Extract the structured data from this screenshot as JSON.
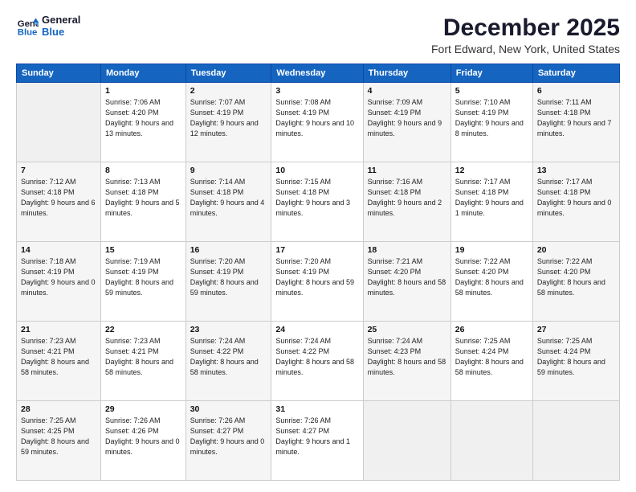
{
  "header": {
    "logo_line1": "General",
    "logo_line2": "Blue",
    "title": "December 2025",
    "subtitle": "Fort Edward, New York, United States"
  },
  "weekdays": [
    "Sunday",
    "Monday",
    "Tuesday",
    "Wednesday",
    "Thursday",
    "Friday",
    "Saturday"
  ],
  "weeks": [
    [
      {
        "day": "",
        "sunrise": "",
        "sunset": "",
        "daylight": ""
      },
      {
        "day": "1",
        "sunrise": "Sunrise: 7:06 AM",
        "sunset": "Sunset: 4:20 PM",
        "daylight": "Daylight: 9 hours and 13 minutes."
      },
      {
        "day": "2",
        "sunrise": "Sunrise: 7:07 AM",
        "sunset": "Sunset: 4:19 PM",
        "daylight": "Daylight: 9 hours and 12 minutes."
      },
      {
        "day": "3",
        "sunrise": "Sunrise: 7:08 AM",
        "sunset": "Sunset: 4:19 PM",
        "daylight": "Daylight: 9 hours and 10 minutes."
      },
      {
        "day": "4",
        "sunrise": "Sunrise: 7:09 AM",
        "sunset": "Sunset: 4:19 PM",
        "daylight": "Daylight: 9 hours and 9 minutes."
      },
      {
        "day": "5",
        "sunrise": "Sunrise: 7:10 AM",
        "sunset": "Sunset: 4:19 PM",
        "daylight": "Daylight: 9 hours and 8 minutes."
      },
      {
        "day": "6",
        "sunrise": "Sunrise: 7:11 AM",
        "sunset": "Sunset: 4:18 PM",
        "daylight": "Daylight: 9 hours and 7 minutes."
      }
    ],
    [
      {
        "day": "7",
        "sunrise": "Sunrise: 7:12 AM",
        "sunset": "Sunset: 4:18 PM",
        "daylight": "Daylight: 9 hours and 6 minutes."
      },
      {
        "day": "8",
        "sunrise": "Sunrise: 7:13 AM",
        "sunset": "Sunset: 4:18 PM",
        "daylight": "Daylight: 9 hours and 5 minutes."
      },
      {
        "day": "9",
        "sunrise": "Sunrise: 7:14 AM",
        "sunset": "Sunset: 4:18 PM",
        "daylight": "Daylight: 9 hours and 4 minutes."
      },
      {
        "day": "10",
        "sunrise": "Sunrise: 7:15 AM",
        "sunset": "Sunset: 4:18 PM",
        "daylight": "Daylight: 9 hours and 3 minutes."
      },
      {
        "day": "11",
        "sunrise": "Sunrise: 7:16 AM",
        "sunset": "Sunset: 4:18 PM",
        "daylight": "Daylight: 9 hours and 2 minutes."
      },
      {
        "day": "12",
        "sunrise": "Sunrise: 7:17 AM",
        "sunset": "Sunset: 4:18 PM",
        "daylight": "Daylight: 9 hours and 1 minute."
      },
      {
        "day": "13",
        "sunrise": "Sunrise: 7:17 AM",
        "sunset": "Sunset: 4:18 PM",
        "daylight": "Daylight: 9 hours and 0 minutes."
      }
    ],
    [
      {
        "day": "14",
        "sunrise": "Sunrise: 7:18 AM",
        "sunset": "Sunset: 4:19 PM",
        "daylight": "Daylight: 9 hours and 0 minutes."
      },
      {
        "day": "15",
        "sunrise": "Sunrise: 7:19 AM",
        "sunset": "Sunset: 4:19 PM",
        "daylight": "Daylight: 8 hours and 59 minutes."
      },
      {
        "day": "16",
        "sunrise": "Sunrise: 7:20 AM",
        "sunset": "Sunset: 4:19 PM",
        "daylight": "Daylight: 8 hours and 59 minutes."
      },
      {
        "day": "17",
        "sunrise": "Sunrise: 7:20 AM",
        "sunset": "Sunset: 4:19 PM",
        "daylight": "Daylight: 8 hours and 59 minutes."
      },
      {
        "day": "18",
        "sunrise": "Sunrise: 7:21 AM",
        "sunset": "Sunset: 4:20 PM",
        "daylight": "Daylight: 8 hours and 58 minutes."
      },
      {
        "day": "19",
        "sunrise": "Sunrise: 7:22 AM",
        "sunset": "Sunset: 4:20 PM",
        "daylight": "Daylight: 8 hours and 58 minutes."
      },
      {
        "day": "20",
        "sunrise": "Sunrise: 7:22 AM",
        "sunset": "Sunset: 4:20 PM",
        "daylight": "Daylight: 8 hours and 58 minutes."
      }
    ],
    [
      {
        "day": "21",
        "sunrise": "Sunrise: 7:23 AM",
        "sunset": "Sunset: 4:21 PM",
        "daylight": "Daylight: 8 hours and 58 minutes."
      },
      {
        "day": "22",
        "sunrise": "Sunrise: 7:23 AM",
        "sunset": "Sunset: 4:21 PM",
        "daylight": "Daylight: 8 hours and 58 minutes."
      },
      {
        "day": "23",
        "sunrise": "Sunrise: 7:24 AM",
        "sunset": "Sunset: 4:22 PM",
        "daylight": "Daylight: 8 hours and 58 minutes."
      },
      {
        "day": "24",
        "sunrise": "Sunrise: 7:24 AM",
        "sunset": "Sunset: 4:22 PM",
        "daylight": "Daylight: 8 hours and 58 minutes."
      },
      {
        "day": "25",
        "sunrise": "Sunrise: 7:24 AM",
        "sunset": "Sunset: 4:23 PM",
        "daylight": "Daylight: 8 hours and 58 minutes."
      },
      {
        "day": "26",
        "sunrise": "Sunrise: 7:25 AM",
        "sunset": "Sunset: 4:24 PM",
        "daylight": "Daylight: 8 hours and 58 minutes."
      },
      {
        "day": "27",
        "sunrise": "Sunrise: 7:25 AM",
        "sunset": "Sunset: 4:24 PM",
        "daylight": "Daylight: 8 hours and 59 minutes."
      }
    ],
    [
      {
        "day": "28",
        "sunrise": "Sunrise: 7:25 AM",
        "sunset": "Sunset: 4:25 PM",
        "daylight": "Daylight: 8 hours and 59 minutes."
      },
      {
        "day": "29",
        "sunrise": "Sunrise: 7:26 AM",
        "sunset": "Sunset: 4:26 PM",
        "daylight": "Daylight: 9 hours and 0 minutes."
      },
      {
        "day": "30",
        "sunrise": "Sunrise: 7:26 AM",
        "sunset": "Sunset: 4:27 PM",
        "daylight": "Daylight: 9 hours and 0 minutes."
      },
      {
        "day": "31",
        "sunrise": "Sunrise: 7:26 AM",
        "sunset": "Sunset: 4:27 PM",
        "daylight": "Daylight: 9 hours and 1 minute."
      },
      {
        "day": "",
        "sunrise": "",
        "sunset": "",
        "daylight": ""
      },
      {
        "day": "",
        "sunrise": "",
        "sunset": "",
        "daylight": ""
      },
      {
        "day": "",
        "sunrise": "",
        "sunset": "",
        "daylight": ""
      }
    ]
  ]
}
